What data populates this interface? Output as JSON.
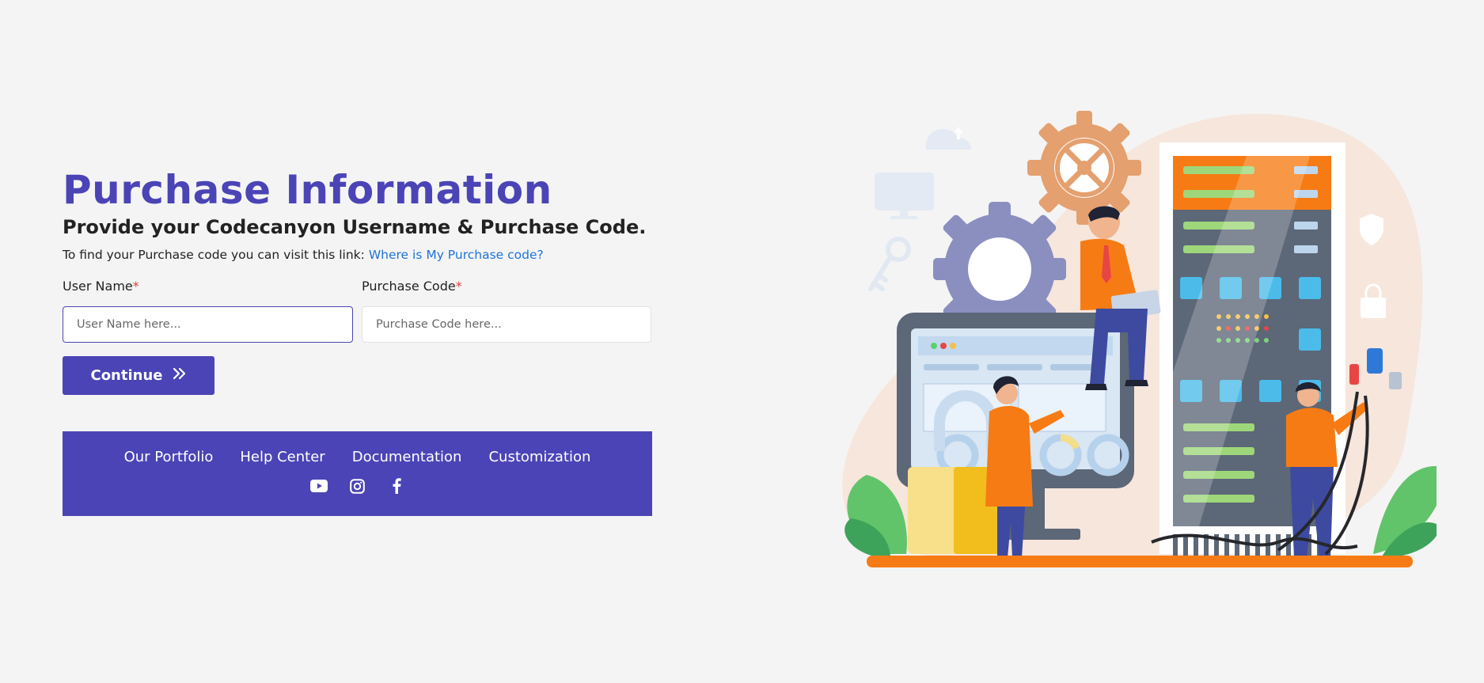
{
  "header": {
    "title": "Purchase Information",
    "subtitle": "Provide your Codecanyon Username & Purchase Code.",
    "hint_text": "To find your Purchase code you can visit this link:",
    "hint_link": "Where is My Purchase code?"
  },
  "form": {
    "username": {
      "label": "User Name",
      "required_mark": "*",
      "placeholder": "User Name here...",
      "value": ""
    },
    "purchase_code": {
      "label": "Purchase Code",
      "required_mark": "*",
      "placeholder": "Purchase Code here...",
      "value": ""
    },
    "submit_label": "Continue"
  },
  "footer": {
    "links": [
      "Our Portfolio",
      "Help Center",
      "Documentation",
      "Customization"
    ],
    "social": [
      "youtube-icon",
      "instagram-icon",
      "facebook-icon"
    ]
  },
  "colors": {
    "brand": "#4b44b6",
    "link": "#1e74d6",
    "required": "#e43a3a",
    "accent_orange": "#f77b14"
  },
  "illustration": {
    "subject": "server-room-team-illustration"
  }
}
